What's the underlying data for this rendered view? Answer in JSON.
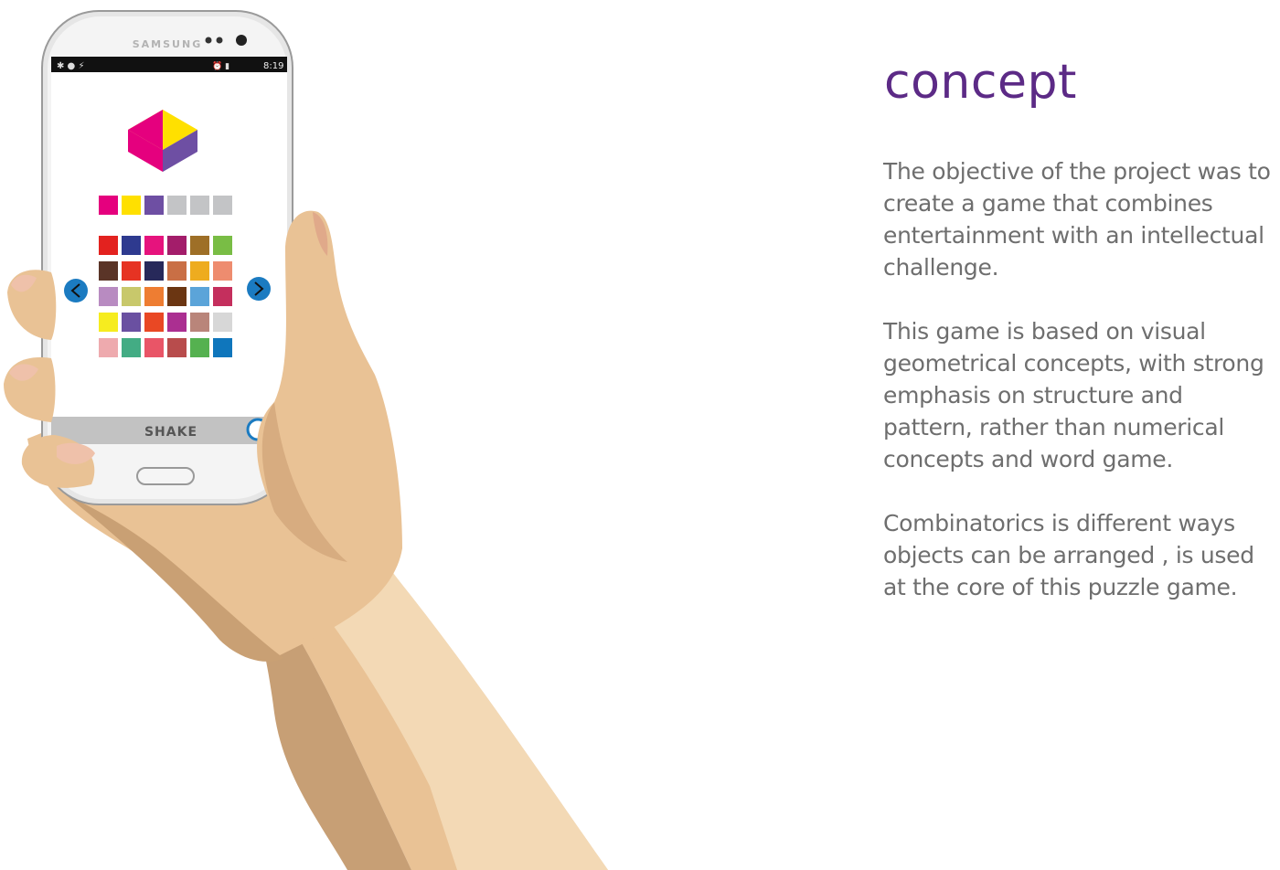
{
  "phone": {
    "brand": "SAMSUNG",
    "status_time": "8:19",
    "shake_label": "SHAKE",
    "target_colors": [
      "#e5007e",
      "#ffe000",
      "#6e4fa3"
    ],
    "empty_slots": 3,
    "palette": [
      [
        "#e3221f",
        "#2e3a8f",
        "#e6137d",
        "#a31d6a",
        "#9e6f27",
        "#79bd45"
      ],
      [
        "#5a3427",
        "#e63323",
        "#27295a",
        "#c96f45",
        "#eeac1f",
        "#ee8c6f"
      ],
      [
        "#b88bc1",
        "#c8c86b",
        "#ee7d32",
        "#6b3612",
        "#5ba4d9",
        "#c42f5d"
      ],
      [
        "#f6ec1f",
        "#6a50a1",
        "#e94824",
        "#ab2f91",
        "#b9857a",
        "#d7d7d7"
      ],
      [
        "#eeaaae",
        "#43ac84",
        "#e95567",
        "#b84c4c",
        "#55b150",
        "#0f76bc"
      ]
    ]
  },
  "section": {
    "title": "concept",
    "paragraphs": [
      "The objective of the project was to create a game that combines entertainment with an intellectual challenge.",
      "This game is based on visual geometrical concepts, with strong emphasis on structure and pattern, rather than numerical concepts and word game.",
      "Combinatorics is different ways objects can be arranged , is used at the core of this puzzle game."
    ]
  }
}
